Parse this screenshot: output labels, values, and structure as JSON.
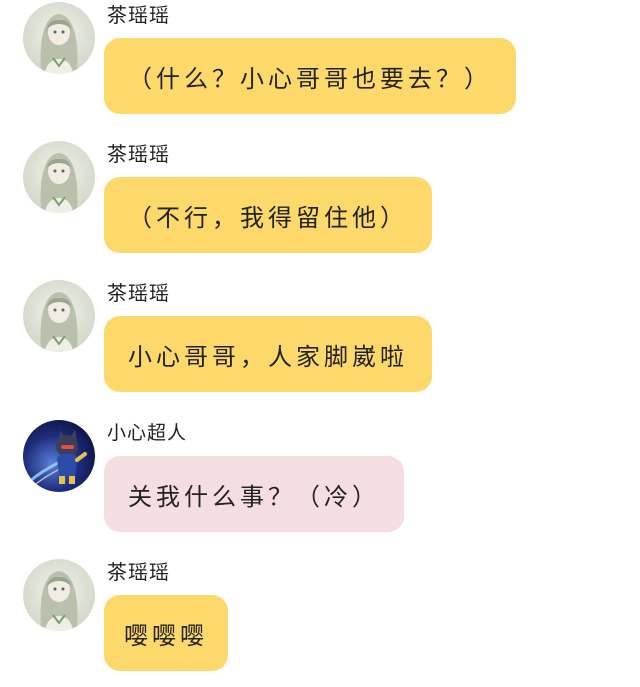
{
  "colors": {
    "self_bubble": "#FCD96A",
    "other_bubble": "#F4DEE1",
    "text": "#222222"
  },
  "messages": [
    {
      "sender": "茶瑶瑶",
      "avatar_icon": "girl-avatar-icon",
      "text": "（什么？小心哥哥也要去？）"
    },
    {
      "sender": "茶瑶瑶",
      "avatar_icon": "girl-avatar-icon",
      "text": "（不行，我得留住他）"
    },
    {
      "sender": "茶瑶瑶",
      "avatar_icon": "girl-avatar-icon",
      "text": "小心哥哥，人家脚崴啦"
    },
    {
      "sender": "小心超人",
      "avatar_icon": "superhero-avatar-icon",
      "text": "关我什么事？（冷）"
    },
    {
      "sender": "茶瑶瑶",
      "avatar_icon": "girl-avatar-icon",
      "text": "嘤嘤嘤"
    }
  ]
}
